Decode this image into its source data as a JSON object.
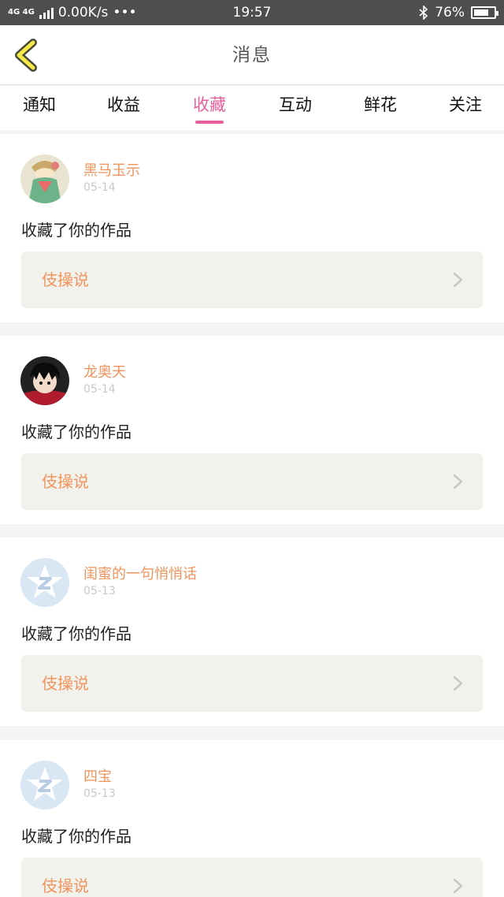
{
  "status_bar": {
    "network": "4G 4G",
    "speed": "0.00K/s",
    "dots": "•••",
    "time": "19:57",
    "bluetooth_icon": "bluetooth-icon",
    "battery": "76%",
    "battery_level": 0.76
  },
  "header": {
    "title": "消息",
    "back_icon": "chevron-left-icon"
  },
  "tabs": [
    {
      "label": "通知",
      "active": false
    },
    {
      "label": "收益",
      "active": false
    },
    {
      "label": "收藏",
      "active": true
    },
    {
      "label": "互动",
      "active": false
    },
    {
      "label": "鲜花",
      "active": false
    },
    {
      "label": "关注",
      "active": false
    }
  ],
  "colors": {
    "accent": "#e8609a",
    "name": "#f0935c",
    "card_box": "#f2f2ec"
  },
  "messages": [
    {
      "name": "黑马玉示",
      "date": "05-14",
      "text": "收藏了你的作品",
      "work": "伎操说",
      "avatar": "anime-girl-avatar"
    },
    {
      "name": "龙奥天",
      "date": "05-14",
      "text": "收藏了你的作品",
      "work": "伎操说",
      "avatar": "black-hair-avatar"
    },
    {
      "name": "闺蜜的一句悄悄话",
      "date": "05-13",
      "text": "收藏了你的作品",
      "work": "伎操说",
      "avatar": "default-star-avatar"
    },
    {
      "name": "四宝",
      "date": "05-13",
      "text": "收藏了你的作品",
      "work": "伎操说",
      "avatar": "default-star-avatar"
    }
  ]
}
